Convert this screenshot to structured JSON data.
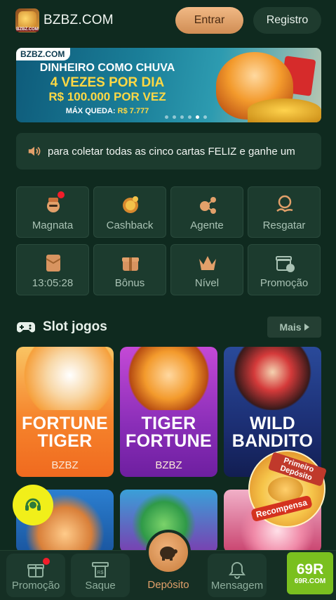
{
  "header": {
    "logo_text": "BZBZ.COM",
    "site_name": "BZBZ.COM",
    "login_label": "Entrar",
    "register_label": "Registro"
  },
  "banner": {
    "tag": "BZBZ.COM",
    "line1": "DINHEIRO COMO CHUVA",
    "line2": "4 VEZES POR DIA",
    "line3": "R$ 100.000 POR VEZ",
    "line4_prefix": "MÁX QUEDA: ",
    "line4_value": "R$ 7.777",
    "slides": 6,
    "active_slide": 5
  },
  "marquee": {
    "text": "para coletar todas as cinco cartas FELIZ e ganhe um"
  },
  "quick_menu": [
    {
      "label": "Magnata",
      "icon": "tycoon-icon",
      "badge": true
    },
    {
      "label": "Cashback",
      "icon": "cashback-icon",
      "badge": false
    },
    {
      "label": "Agente",
      "icon": "agent-icon",
      "badge": false
    },
    {
      "label": "Resgatar",
      "icon": "redeem-icon",
      "badge": false
    },
    {
      "label": "13:05:28",
      "icon": "timer-envelope-icon",
      "badge": false
    },
    {
      "label": "Bônus",
      "icon": "gift-box-icon",
      "badge": false
    },
    {
      "label": "Nível",
      "icon": "crown-icon",
      "badge": false
    },
    {
      "label": "Promoção",
      "icon": "gift-chat-icon",
      "badge": false
    }
  ],
  "section": {
    "title": "Slot jogos",
    "more_label": "Mais"
  },
  "games": [
    {
      "line1": "FORTUNE",
      "line2": "TIGER",
      "provider": "BZBZ"
    },
    {
      "line1": "TIGER",
      "line2": "FORTUNE",
      "provider": "BZBZ"
    },
    {
      "line1": "WILD",
      "line2": "BANDITO",
      "provider": ""
    }
  ],
  "promo_badge": {
    "top": "Primeiro Depósito",
    "bottom": "Recompensa"
  },
  "bottom_nav": {
    "promo_label": "Promoção",
    "withdraw_label": "Saque",
    "deposit_label": "Depósito",
    "message_label": "Mensagem"
  },
  "watermark": {
    "big": "69R",
    "small": "69R.COM"
  },
  "colors": {
    "background": "#0f2a1f",
    "tile": "#1c3b2e",
    "accent": "#d08d54",
    "badge_red": "#f21d2a",
    "support_yellow": "#f1ef1a"
  }
}
